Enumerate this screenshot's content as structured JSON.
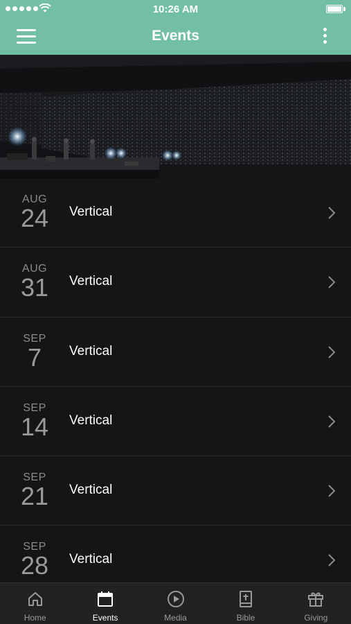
{
  "status_bar": {
    "time": "10:26 AM"
  },
  "nav": {
    "title": "Events"
  },
  "events": [
    {
      "month": "AUG",
      "day": "24",
      "title": "Vertical"
    },
    {
      "month": "AUG",
      "day": "31",
      "title": "Vertical"
    },
    {
      "month": "SEP",
      "day": "7",
      "title": "Vertical"
    },
    {
      "month": "SEP",
      "day": "14",
      "title": "Vertical"
    },
    {
      "month": "SEP",
      "day": "21",
      "title": "Vertical"
    },
    {
      "month": "SEP",
      "day": "28",
      "title": "Vertical"
    }
  ],
  "tabs": [
    {
      "label": "Home",
      "icon": "home-icon",
      "active": false
    },
    {
      "label": "Events",
      "icon": "calendar-icon",
      "active": true
    },
    {
      "label": "Media",
      "icon": "play-icon",
      "active": false
    },
    {
      "label": "Bible",
      "icon": "bible-icon",
      "active": false
    },
    {
      "label": "Giving",
      "icon": "gift-icon",
      "active": false
    }
  ],
  "colors": {
    "accent": "#72bfa3",
    "background": "#151517",
    "tab_bar": "#222224"
  }
}
